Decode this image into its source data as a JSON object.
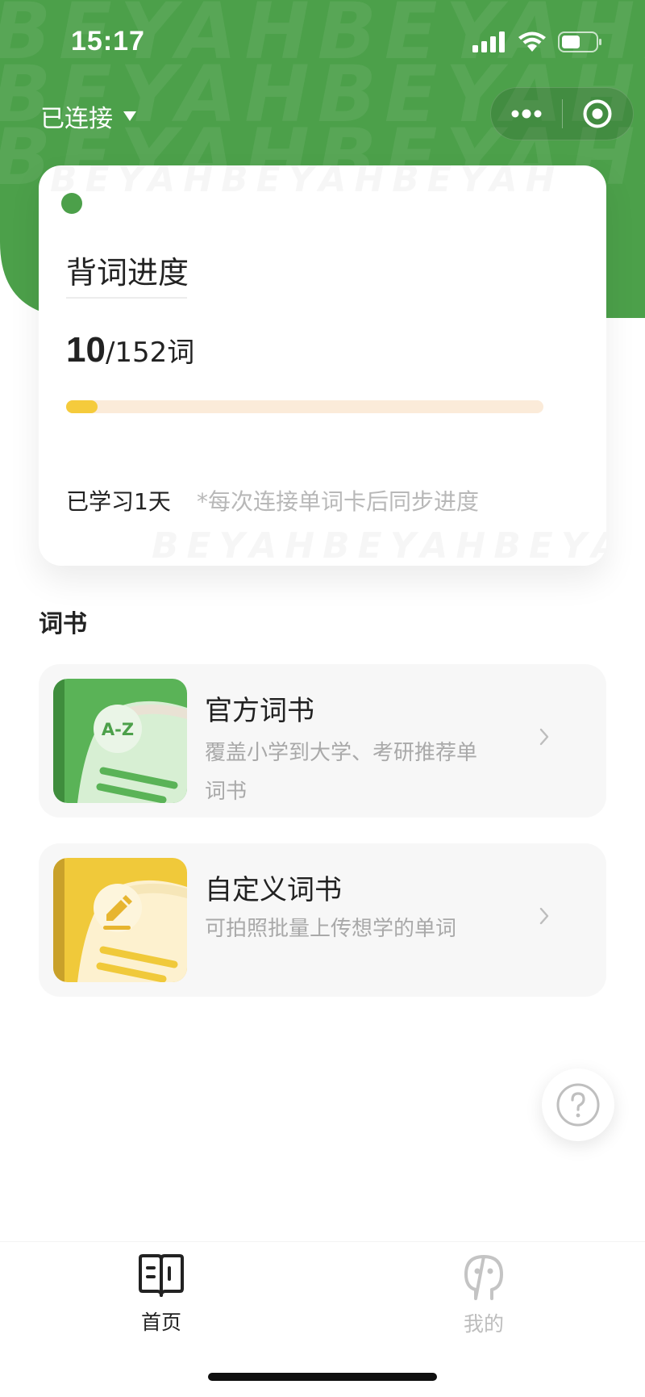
{
  "status_bar": {
    "time": "15:17"
  },
  "header": {
    "connection_label": "已连接",
    "watermark_text": "BEYAHBEYAHBEYAH"
  },
  "progress_card": {
    "title": "背词进度",
    "learned_count": "10",
    "total_text": "/152词",
    "progress_fraction": 0.066,
    "days_text": "已学习1天",
    "sync_note": "*每次连接单词卡后同步进度",
    "watermark_top": "BEYAHBEYAHBEYAH",
    "watermark_bottom": "BEYAHBEYAHBEYA"
  },
  "books_section": {
    "title": "词书",
    "items": [
      {
        "name": "官方词书",
        "description": "覆盖小学到大学、考研推荐单词书",
        "cover_badge": "A-Z",
        "cover_color": "#4ca04a"
      },
      {
        "name": "自定义词书",
        "description": "可拍照批量上传想学的单词",
        "cover_badge": "edit-icon",
        "cover_color": "#f0c93a"
      }
    ]
  },
  "tabbar": {
    "tabs": [
      {
        "label": "首页",
        "icon": "book-open-icon",
        "active": true
      },
      {
        "label": "我的",
        "icon": "person-icon",
        "active": false
      }
    ]
  },
  "colors": {
    "brand_green": "#4ca04a",
    "progress_fill": "#f5cb3c",
    "progress_track": "#fbebd9"
  }
}
